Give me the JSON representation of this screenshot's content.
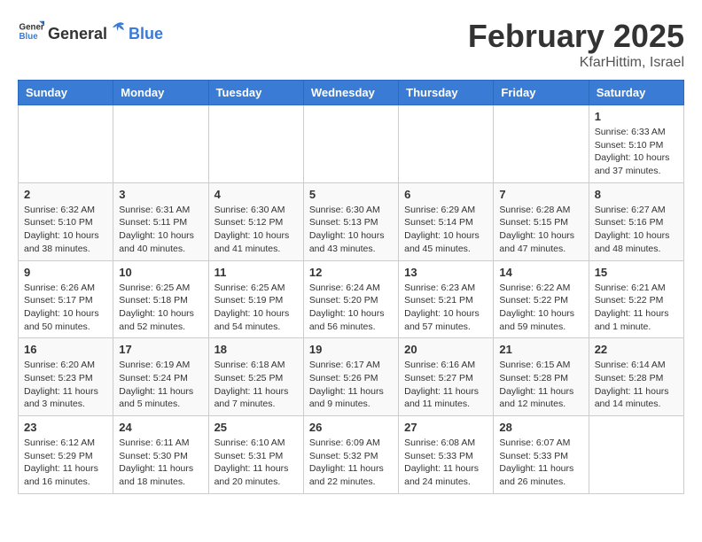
{
  "header": {
    "logo_general": "General",
    "logo_blue": "Blue",
    "month_year": "February 2025",
    "location": "KfarHittim, Israel"
  },
  "weekdays": [
    "Sunday",
    "Monday",
    "Tuesday",
    "Wednesday",
    "Thursday",
    "Friday",
    "Saturday"
  ],
  "weeks": [
    [
      {
        "day": "",
        "info": ""
      },
      {
        "day": "",
        "info": ""
      },
      {
        "day": "",
        "info": ""
      },
      {
        "day": "",
        "info": ""
      },
      {
        "day": "",
        "info": ""
      },
      {
        "day": "",
        "info": ""
      },
      {
        "day": "1",
        "info": "Sunrise: 6:33 AM\nSunset: 5:10 PM\nDaylight: 10 hours and 37 minutes."
      }
    ],
    [
      {
        "day": "2",
        "info": "Sunrise: 6:32 AM\nSunset: 5:10 PM\nDaylight: 10 hours and 38 minutes."
      },
      {
        "day": "3",
        "info": "Sunrise: 6:31 AM\nSunset: 5:11 PM\nDaylight: 10 hours and 40 minutes."
      },
      {
        "day": "4",
        "info": "Sunrise: 6:30 AM\nSunset: 5:12 PM\nDaylight: 10 hours and 41 minutes."
      },
      {
        "day": "5",
        "info": "Sunrise: 6:30 AM\nSunset: 5:13 PM\nDaylight: 10 hours and 43 minutes."
      },
      {
        "day": "6",
        "info": "Sunrise: 6:29 AM\nSunset: 5:14 PM\nDaylight: 10 hours and 45 minutes."
      },
      {
        "day": "7",
        "info": "Sunrise: 6:28 AM\nSunset: 5:15 PM\nDaylight: 10 hours and 47 minutes."
      },
      {
        "day": "8",
        "info": "Sunrise: 6:27 AM\nSunset: 5:16 PM\nDaylight: 10 hours and 48 minutes."
      }
    ],
    [
      {
        "day": "9",
        "info": "Sunrise: 6:26 AM\nSunset: 5:17 PM\nDaylight: 10 hours and 50 minutes."
      },
      {
        "day": "10",
        "info": "Sunrise: 6:25 AM\nSunset: 5:18 PM\nDaylight: 10 hours and 52 minutes."
      },
      {
        "day": "11",
        "info": "Sunrise: 6:25 AM\nSunset: 5:19 PM\nDaylight: 10 hours and 54 minutes."
      },
      {
        "day": "12",
        "info": "Sunrise: 6:24 AM\nSunset: 5:20 PM\nDaylight: 10 hours and 56 minutes."
      },
      {
        "day": "13",
        "info": "Sunrise: 6:23 AM\nSunset: 5:21 PM\nDaylight: 10 hours and 57 minutes."
      },
      {
        "day": "14",
        "info": "Sunrise: 6:22 AM\nSunset: 5:22 PM\nDaylight: 10 hours and 59 minutes."
      },
      {
        "day": "15",
        "info": "Sunrise: 6:21 AM\nSunset: 5:22 PM\nDaylight: 11 hours and 1 minute."
      }
    ],
    [
      {
        "day": "16",
        "info": "Sunrise: 6:20 AM\nSunset: 5:23 PM\nDaylight: 11 hours and 3 minutes."
      },
      {
        "day": "17",
        "info": "Sunrise: 6:19 AM\nSunset: 5:24 PM\nDaylight: 11 hours and 5 minutes."
      },
      {
        "day": "18",
        "info": "Sunrise: 6:18 AM\nSunset: 5:25 PM\nDaylight: 11 hours and 7 minutes."
      },
      {
        "day": "19",
        "info": "Sunrise: 6:17 AM\nSunset: 5:26 PM\nDaylight: 11 hours and 9 minutes."
      },
      {
        "day": "20",
        "info": "Sunrise: 6:16 AM\nSunset: 5:27 PM\nDaylight: 11 hours and 11 minutes."
      },
      {
        "day": "21",
        "info": "Sunrise: 6:15 AM\nSunset: 5:28 PM\nDaylight: 11 hours and 12 minutes."
      },
      {
        "day": "22",
        "info": "Sunrise: 6:14 AM\nSunset: 5:28 PM\nDaylight: 11 hours and 14 minutes."
      }
    ],
    [
      {
        "day": "23",
        "info": "Sunrise: 6:12 AM\nSunset: 5:29 PM\nDaylight: 11 hours and 16 minutes."
      },
      {
        "day": "24",
        "info": "Sunrise: 6:11 AM\nSunset: 5:30 PM\nDaylight: 11 hours and 18 minutes."
      },
      {
        "day": "25",
        "info": "Sunrise: 6:10 AM\nSunset: 5:31 PM\nDaylight: 11 hours and 20 minutes."
      },
      {
        "day": "26",
        "info": "Sunrise: 6:09 AM\nSunset: 5:32 PM\nDaylight: 11 hours and 22 minutes."
      },
      {
        "day": "27",
        "info": "Sunrise: 6:08 AM\nSunset: 5:33 PM\nDaylight: 11 hours and 24 minutes."
      },
      {
        "day": "28",
        "info": "Sunrise: 6:07 AM\nSunset: 5:33 PM\nDaylight: 11 hours and 26 minutes."
      },
      {
        "day": "",
        "info": ""
      }
    ]
  ]
}
